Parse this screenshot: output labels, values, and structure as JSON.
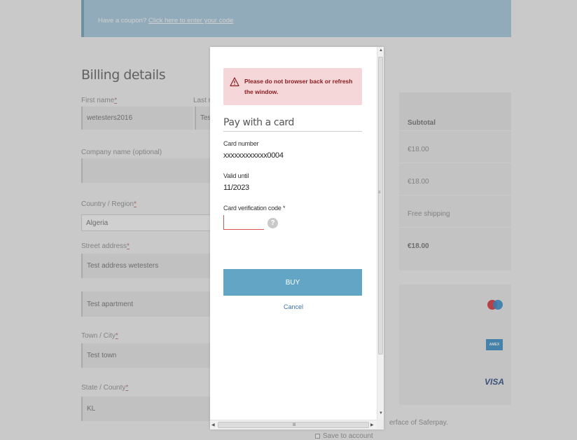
{
  "checkout": {
    "coupon_text": "Have a coupon?",
    "coupon_link": "Click here to enter your code",
    "billing_title": "Billing details",
    "required_mark": "*",
    "first_name_label": "First name",
    "first_name_value": "wetesters2016",
    "last_name_label": "Last n",
    "last_name_value": "Test",
    "company_label": "Company name (optional)",
    "country_label": "Country / Region",
    "country_value": "Algeria",
    "street_label": "Street address",
    "street_value": "Test address wetesters",
    "apartment_value": "Test apartment",
    "city_label": "Town / City",
    "city_value": "Test town",
    "state_label": "State / County",
    "state_value": "KL",
    "save_to_account": "Save to account",
    "saferpay_text": "erface of Saferpay."
  },
  "order": {
    "subtotal_label": "Subtotal",
    "line_price": "€18.00",
    "subtotal_price": "€18.00",
    "shipping": "Free shipping",
    "total": "€18.00"
  },
  "payment_icons": [
    "mastercard-icon",
    "amex-icon",
    "visa-icon"
  ],
  "payment_brand_visa": "VISA",
  "modal": {
    "alert_text": "Please do not browser back or refresh the window.",
    "pay_title": "Pay with a card",
    "card_number_label": "Card number",
    "card_number_value": "xxxxxxxxxxxx0004",
    "valid_until_label": "Valid until",
    "valid_until_value": "11/2023",
    "cvc_label": "Card verification code *",
    "cvc_value": "",
    "help_glyph": "?",
    "buy_label": "BUY",
    "cancel_label": "Cancel"
  },
  "colors": {
    "alert_bg": "#f5d7d9",
    "alert_text": "#8a1d20",
    "buy_button": "#62a5c5",
    "coupon_bar": "#9fc6dd",
    "cancel_link": "#3c6fae"
  }
}
